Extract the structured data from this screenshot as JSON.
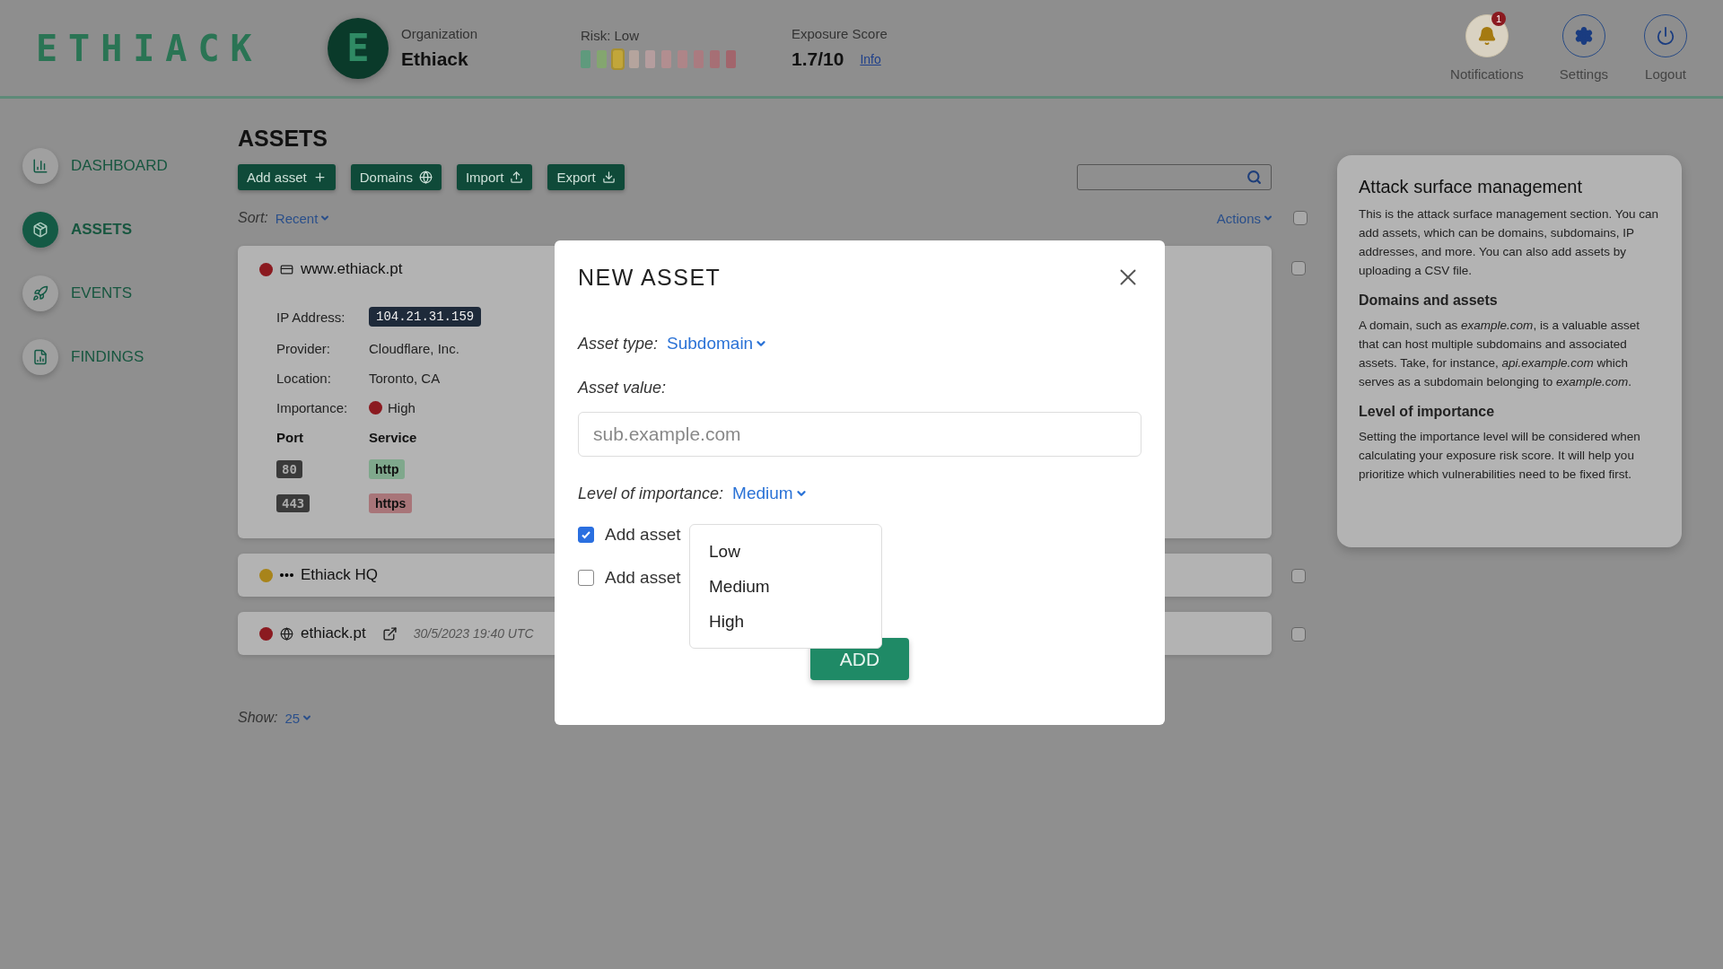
{
  "header": {
    "logo": "ETHIACK",
    "organization": {
      "label": "Organization",
      "name": "Ethiack",
      "avatar_letter": "E"
    },
    "risk": {
      "label": "Risk: Low",
      "segments": [
        {
          "color": "#5f9a7d",
          "selected": false
        },
        {
          "color": "#84a66f",
          "selected": false
        },
        {
          "color": "#c2a63a",
          "selected": true
        },
        {
          "color": "#b5a49d",
          "selected": false
        },
        {
          "color": "#b59d9e",
          "selected": false
        },
        {
          "color": "#b28e90",
          "selected": false
        },
        {
          "color": "#ae8588",
          "selected": false
        },
        {
          "color": "#aa7b80",
          "selected": false
        },
        {
          "color": "#a66f75",
          "selected": false
        },
        {
          "color": "#a2656c",
          "selected": false
        }
      ]
    },
    "exposure": {
      "label": "Exposure Score",
      "value": "1.7/10",
      "link": "Info"
    },
    "actions": [
      {
        "kind": "notifications",
        "label": "Notifications",
        "badge": "1"
      },
      {
        "kind": "settings",
        "label": "Settings"
      },
      {
        "kind": "logout",
        "label": "Logout"
      }
    ]
  },
  "sidebar": {
    "items": [
      {
        "kind": "dashboard",
        "label": "DASHBOARD",
        "selected": false
      },
      {
        "kind": "assets",
        "label": "ASSETS",
        "selected": true
      },
      {
        "kind": "events",
        "label": "EVENTS",
        "selected": false
      },
      {
        "kind": "findings",
        "label": "FINDINGS",
        "selected": false
      }
    ]
  },
  "main": {
    "title": "ASSETS",
    "toolbar": [
      {
        "kind": "add",
        "label": "Add asset"
      },
      {
        "kind": "domains",
        "label": "Domains"
      },
      {
        "kind": "import",
        "label": "Import"
      },
      {
        "kind": "export",
        "label": "Export"
      }
    ],
    "sort": {
      "label": "Sort:",
      "value": "Recent"
    },
    "actions": {
      "label": "Actions",
      "checked": false
    },
    "assets": [
      {
        "kind": "host",
        "name": "www.ethiack.pt",
        "color": "#8b1a20",
        "expanded": true,
        "checked": false,
        "details": [
          {
            "label": "IP Address:",
            "value": "104.21.31.159",
            "kind": "code"
          },
          {
            "label": "Provider:",
            "value": "Cloudflare, Inc.",
            "kind": "text"
          },
          {
            "label": "Location:",
            "value": "Toronto, CA",
            "kind": "text"
          },
          {
            "label": "Importance:",
            "value": "High",
            "kind": "importance",
            "color": "#8b1a20"
          }
        ],
        "ports": {
          "columns": [
            "Port",
            "Service"
          ],
          "rows": [
            {
              "port": "80",
              "service": "http",
              "color": "#7fa88c"
            },
            {
              "port": "443",
              "service": "https",
              "color": "#a87579"
            }
          ]
        }
      },
      {
        "kind": "location",
        "name": "Ethiack HQ",
        "color": "#a8841a",
        "expanded": false,
        "checked": false
      },
      {
        "kind": "domain",
        "name": "ethiack.pt",
        "color": "#8b1a20",
        "expanded": false,
        "checked": false,
        "date": "30/5/2023 19:40 UTC"
      }
    ],
    "show": {
      "label": "Show:",
      "value": "25"
    }
  },
  "help": {
    "title": "Attack surface management",
    "sections": [
      {
        "text": "This is the attack surface management section. You can add assets, which can be domains, subdomains, IP addresses, and more. You can also add assets by uploading a CSV file."
      },
      {
        "heading": "Domains and assets",
        "text": "A domain, such as *example.com*, is a valuable asset that can host multiple subdomains and associated assets. Take, for instance, *api.example.com* which serves as a subdomain belonging to *example.com*."
      },
      {
        "heading": "Level of importance",
        "text": "Setting the importance level will be considered when calculating your exposure risk score. It will help you prioritize which vulnerabilities need to be fixed first."
      }
    ]
  },
  "modal": {
    "title": "NEW ASSET",
    "asset_type": {
      "label": "Asset type:",
      "value": "Subdomain"
    },
    "asset_value": {
      "label": "Asset value:",
      "placeholder": "sub.example.com"
    },
    "importance": {
      "label": "Level of importance:",
      "value": "Medium",
      "expanded": true,
      "options": [
        "Low",
        "Medium",
        "High"
      ]
    },
    "checkboxes": [
      {
        "label": "Add asset",
        "checked": true
      },
      {
        "label": "Add asset",
        "checked": false
      }
    ],
    "submit": "ADD"
  }
}
